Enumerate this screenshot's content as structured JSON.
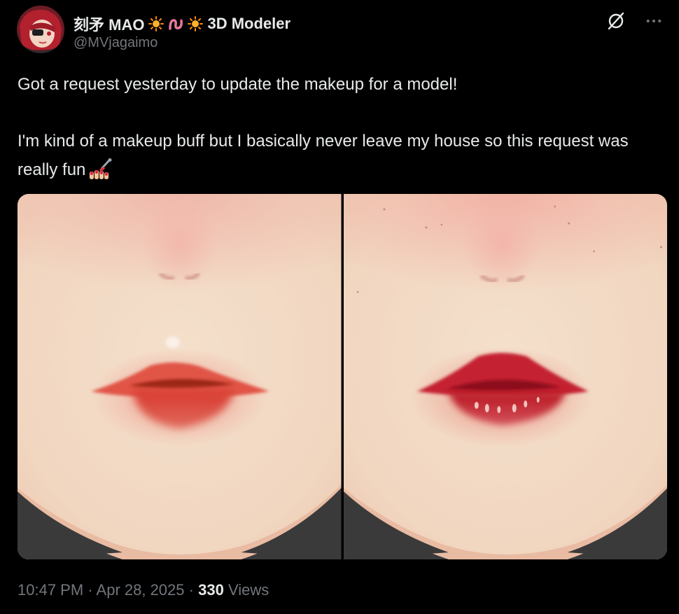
{
  "author": {
    "display_name": "刻矛 MAO",
    "title_suffix": "3D Modeler",
    "handle": "@MVjagaimo",
    "emoji_icons": [
      "sun-icon",
      "worm-icon",
      "sun-icon"
    ]
  },
  "post": {
    "line1": "Got a request yesterday to update the makeup for a model!",
    "line2": "I'm kind of a makeup buff but I basically never leave my house so this request was really fun",
    "trailing_emoji": "nail-polish-icon"
  },
  "media": {
    "count": 2,
    "panels": [
      "before-makeup-render",
      "after-makeup-render"
    ]
  },
  "meta": {
    "time": "10:47 PM",
    "separator": "·",
    "date": "Apr 28, 2025",
    "views_count": "330",
    "views_label": "Views"
  },
  "colors": {
    "background": "#000000",
    "text": "#e7e9ea",
    "muted": "#71767b",
    "skin": "#f3dcc6",
    "lip_before": "#d9443a",
    "lip_after": "#c4202b"
  }
}
